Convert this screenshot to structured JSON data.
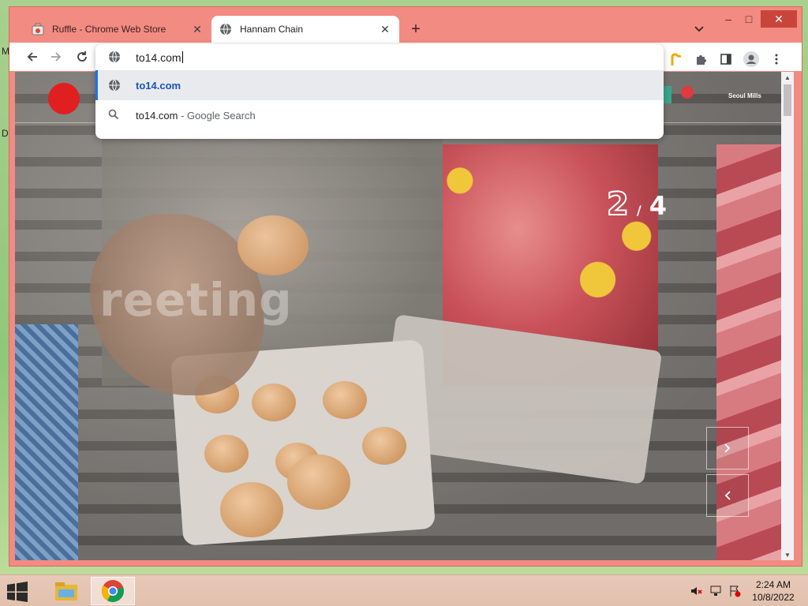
{
  "desktop": {
    "edge_letters": [
      "M",
      "D"
    ]
  },
  "browser": {
    "tabs": [
      {
        "title": "Ruffle - Chrome Web Store",
        "active": false
      },
      {
        "title": "Hannam Chain",
        "active": true
      }
    ],
    "new_tab_label": "+",
    "window_controls": {
      "minimize": "–",
      "maximize": "□",
      "close": "✕"
    },
    "omnibox": {
      "value": "to14.com",
      "suggestions": [
        {
          "text": "to14.com",
          "kind": "url",
          "selected": true
        },
        {
          "text": "to14.com",
          "suffix": " - Google Search",
          "kind": "search",
          "selected": false
        }
      ]
    },
    "accent_color": "#f28b82"
  },
  "page": {
    "hero_text": "reeting",
    "slide_counter": {
      "current": "2",
      "separator": "/",
      "total": "4"
    },
    "partner_logos": [
      "Seoul Mills"
    ],
    "slide_next_icon": "chevron-right-icon",
    "slide_prev_icon": "chevron-left-icon"
  },
  "taskbar": {
    "clock": {
      "time": "2:24 AM",
      "date": "10/8/2022"
    }
  }
}
